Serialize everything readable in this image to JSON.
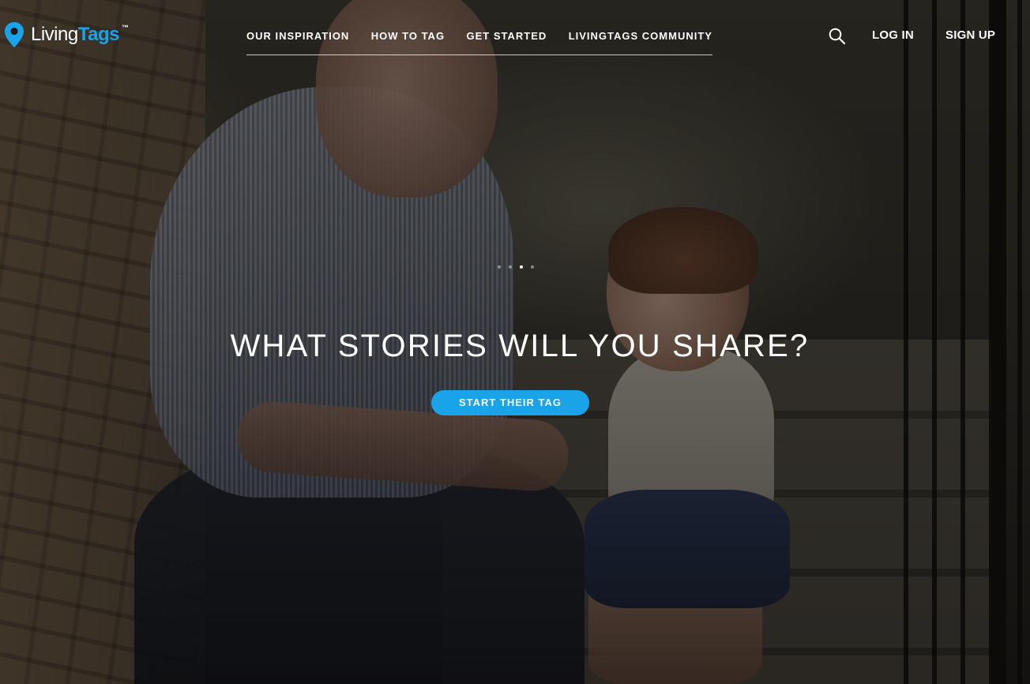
{
  "brand": {
    "name_part_1": "Living",
    "name_part_2": "Tags",
    "trademark": "™",
    "accent_color": "#1aa3e8",
    "icon": "map-pin-icon"
  },
  "nav": {
    "items": [
      {
        "label": "OUR INSPIRATION"
      },
      {
        "label": "HOW TO TAG"
      },
      {
        "label": "GET STARTED"
      },
      {
        "label": "LIVINGTAGS COMMUNITY"
      }
    ]
  },
  "header": {
    "search_icon": "search-icon",
    "login_label": "LOG IN",
    "signup_label": "SIGN UP"
  },
  "hero": {
    "headline": "WHAT STORIES WILL YOU SHARE?",
    "cta_label": "START THEIR TAG",
    "carousel": {
      "slide_count": 4,
      "active_slide": 3
    }
  }
}
